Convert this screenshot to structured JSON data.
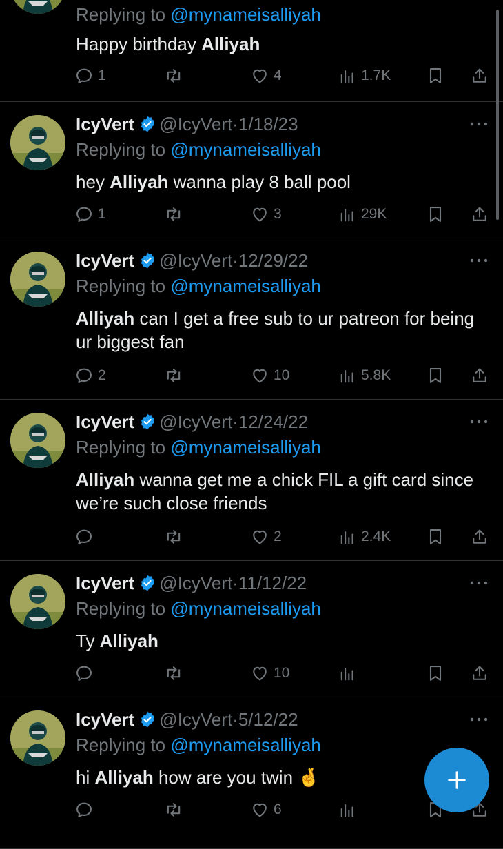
{
  "top_partial": {
    "reply_prefix": "Replying to",
    "reply_to": "@mynameisalliyah",
    "body_plain": "Happy birthday ",
    "body_bold": "Alliyah",
    "replies": "1",
    "retweets": "",
    "likes": "4",
    "views": "1.7K"
  },
  "author": {
    "name": "IcyVert",
    "handle": "@IcyVert",
    "dot": "·"
  },
  "tweets": [
    {
      "date": "1/18/23",
      "reply_prefix": "Replying to",
      "reply_to": "@mynameisalliyah",
      "body_pre": "hey ",
      "body_bold": "Alliyah",
      "body_post": " wanna play 8 ball pool",
      "replies": "1",
      "likes": "3",
      "views": "29K"
    },
    {
      "date": "12/29/22",
      "reply_prefix": "Replying to",
      "reply_to": "@mynameisalliyah",
      "body_pre": "",
      "body_bold": "Alliyah",
      "body_post": " can I get a free sub to ur patreon for being ur biggest fan",
      "replies": "2",
      "likes": "10",
      "views": "5.8K"
    },
    {
      "date": "12/24/22",
      "reply_prefix": "Replying to",
      "reply_to": "@mynameisalliyah",
      "body_pre": "",
      "body_bold": "Alliyah",
      "body_post": " wanna get me a chick FIL a gift card since we’re such close friends",
      "replies": "",
      "likes": "2",
      "views": "2.4K"
    },
    {
      "date": "11/12/22",
      "reply_prefix": "Replying to",
      "reply_to": "@mynameisalliyah",
      "body_pre": "Ty ",
      "body_bold": "Alliyah",
      "body_post": "",
      "replies": "",
      "likes": "10",
      "views": ""
    },
    {
      "date": "5/12/22",
      "reply_prefix": "Replying to",
      "reply_to": "@mynameisalliyah",
      "body_pre": "hi ",
      "body_bold": "Alliyah",
      "body_post": " how are you twin 🤞",
      "replies": "",
      "likes": "6",
      "views": ""
    }
  ],
  "icons": {
    "reply": "speech-bubble-icon",
    "retweet": "retweet-arrows-icon",
    "like": "heart-icon",
    "views": "bar-chart-icon",
    "bookmark": "bookmark-icon",
    "share": "share-upload-icon",
    "verified": "verified-badge-icon",
    "more": "more-dots-icon",
    "compose": "plus-icon"
  },
  "colors": {
    "background": "#000000",
    "text": "#e7e9ea",
    "muted": "#71767b",
    "accent": "#1d9bf0",
    "fab": "#1d8ad4",
    "divider": "#2f3336"
  }
}
